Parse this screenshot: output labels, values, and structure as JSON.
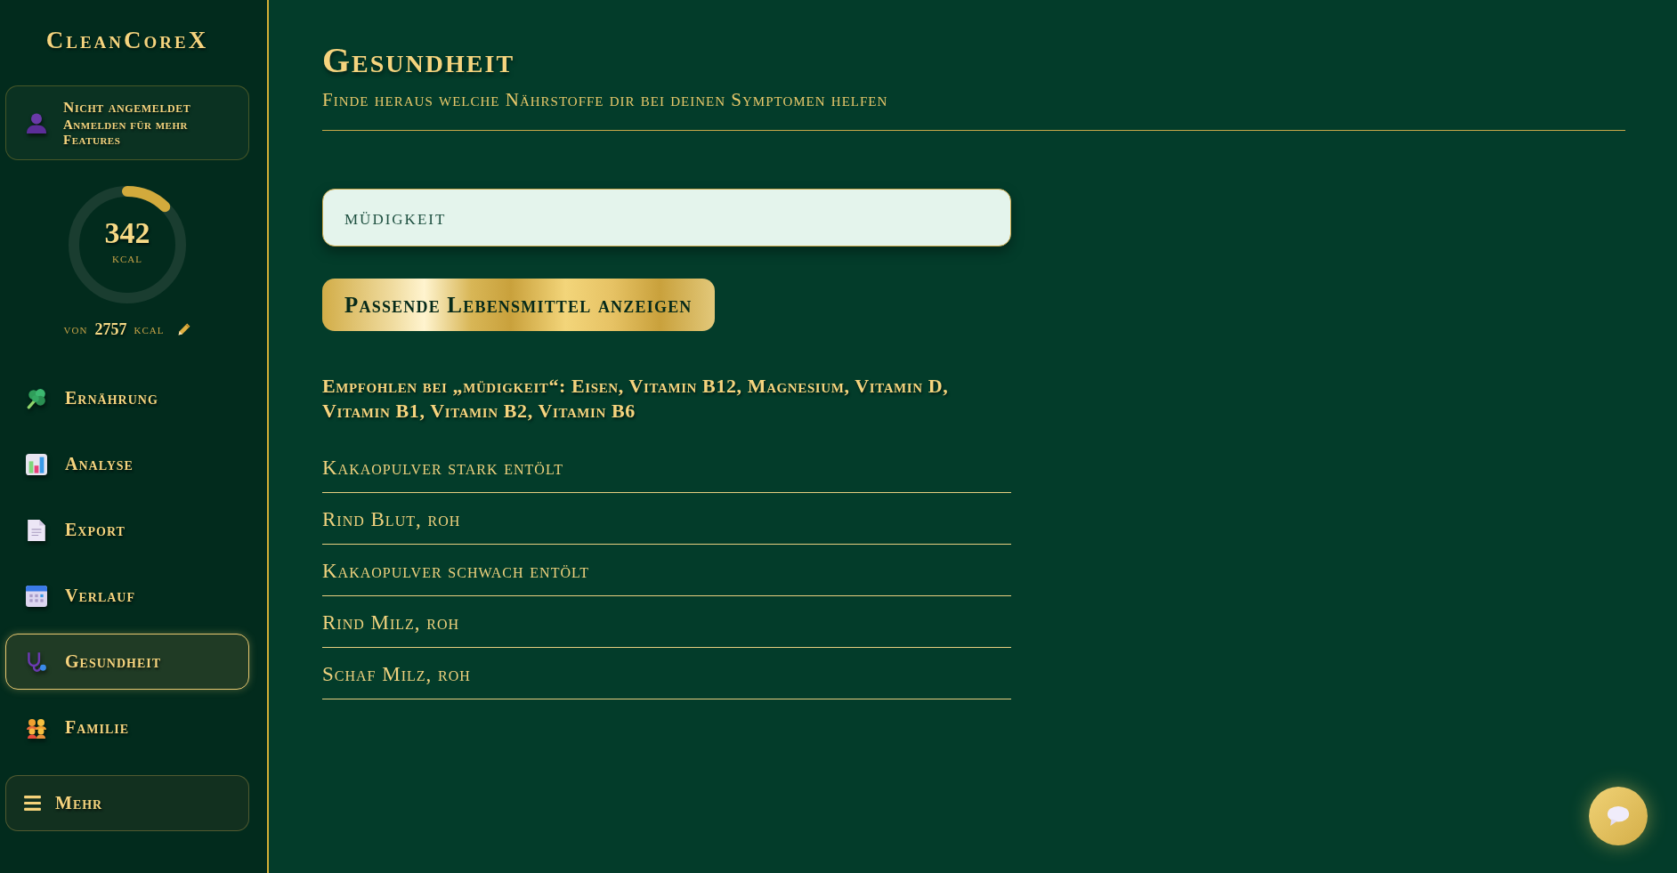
{
  "sidebar": {
    "logo": "CleanCoreX",
    "user_card": {
      "status": "Nicht angemeldet",
      "hint": "Anmelden für mehr Features"
    },
    "calories": {
      "value": "342",
      "unit": "kcal",
      "level": 0.124,
      "goal_prefix": "von",
      "goal": "2757",
      "goal_unit": "kcal"
    },
    "nav_items": [
      {
        "label": "Ernährung",
        "selected": false
      },
      {
        "label": "Analyse",
        "selected": false
      },
      {
        "label": "Export",
        "selected": false
      },
      {
        "label": "Verlauf",
        "selected": false
      },
      {
        "label": "Gesundheit",
        "selected": true
      },
      {
        "label": "Familie",
        "selected": false
      }
    ],
    "more_button": {
      "label": "Mehr"
    }
  },
  "main": {
    "title": "Gesundheit",
    "subtitle": "Finde heraus welche Nährstoffe dir bei deinen Symptomen helfen",
    "symptom_field": {
      "value": "müdigkeit"
    },
    "submit_button": "Passende Lebensmittel anzeigen",
    "recommendation": "Empfohlen bei „müdigkeit“: Eisen, Vitamin B12, Magnesium, Vitamin D, Vitamin B1, Vitamin B2, Vitamin B6",
    "foods": [
      "Kakaopulver stark entölt",
      "Rind Blut, roh",
      "Kakaopulver schwach entölt",
      "Rind Milz, roh",
      "Schaf Milz, roh"
    ]
  }
}
